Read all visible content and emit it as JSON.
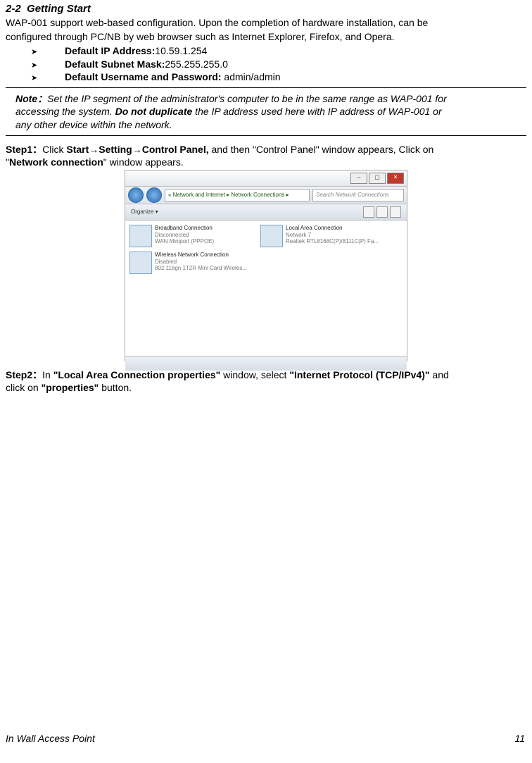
{
  "section": {
    "number": "2-2",
    "title": "Getting Start"
  },
  "intro": {
    "line1": "WAP-001 support web-based configuration. Upon the completion of hardware installation, can be",
    "line2": "configured through PC/NB by web browser such as Internet Explorer, Firefox, and Opera."
  },
  "defaults": {
    "ip_label": "Default IP Address:",
    "ip_value": "10.59.1.254",
    "mask_label": "Default Subnet Mask:",
    "mask_value": "255.255.255.0",
    "creds_label": "Default Username and Password:",
    "creds_value": " admin/admin"
  },
  "note": {
    "label": "Note：",
    "line1a": "Set the IP segment of the administrator's computer to be in the same range as WAP-001 for",
    "line2a": "accessing the system. ",
    "bold": "Do not duplicate",
    "line2b": " the IP address used here with IP address of WAP-001 or",
    "line3": "any other device within the network."
  },
  "step1": {
    "prefix": "Step1：",
    "t1": "Click ",
    "b1": "Start",
    "arrow1": "→",
    "b2": "Setting",
    "arrow2": "→",
    "b3": "Control Panel,",
    "t2": " and then \"Control Panel\" window appears, Click on",
    "q": "\"",
    "b4": "Network connection",
    "t3": "\" window appears."
  },
  "screenshot": {
    "breadcrumb": "« Network and Internet ▸ Network Connections ▸",
    "search_placeholder": "Search Network Connections",
    "organize": "Organize ▾",
    "items": [
      {
        "t1": "Broadband Connection",
        "t2": "Disconnected",
        "t3": "WAN Miniport (PPPOE)"
      },
      {
        "t1": "Local Area Connection",
        "t2": "Network 7",
        "t3": "Realtek RTL8168C(P)/8111C(P) Fa..."
      },
      {
        "t1": "Wireless Network Connection",
        "t2": "Disabled",
        "t3": "802.11bgn 1T2R Mini Card Wireles..."
      }
    ]
  },
  "step2": {
    "prefix": "Step2：",
    "t1": "In ",
    "b1": "\"Local Area Connection properties\"",
    "t2": " window, select ",
    "b2": "\"Internet Protocol (TCP/IPv4)\"",
    "t3": " and",
    "line2a": "click on ",
    "b3": "\"properties\"",
    "line2b": " button."
  },
  "footer": {
    "left": "In Wall Access Point",
    "right": "11"
  }
}
